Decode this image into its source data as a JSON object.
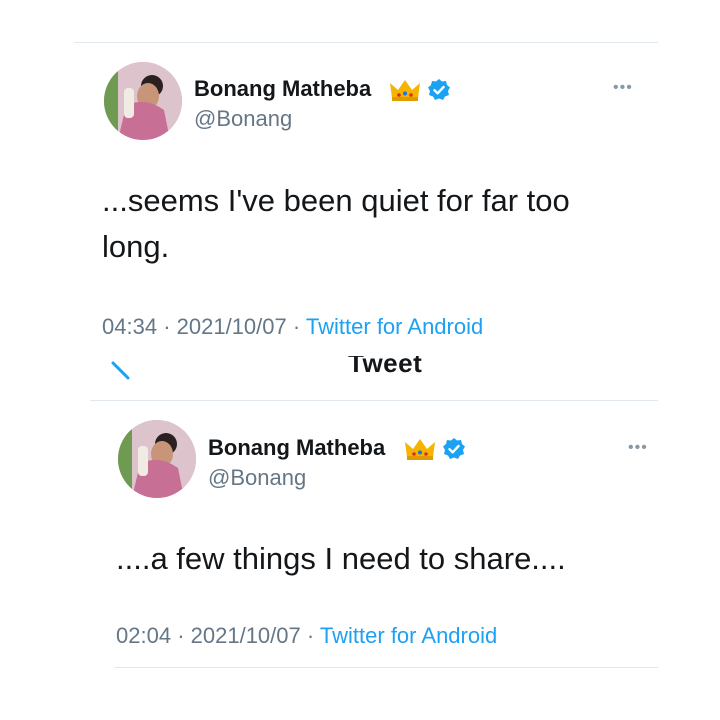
{
  "tweet1": {
    "name": "Bonang Matheba",
    "handle": "@Bonang",
    "text": "...seems I've been quiet for far too long.",
    "time": "04:34",
    "date": "2021/10/07",
    "separator": "·",
    "source": "Twitter for Android",
    "more": "•••"
  },
  "header": {
    "title": "Tweet"
  },
  "tweet2": {
    "name": "Bonang Matheba",
    "handle": "@Bonang",
    "text": "....a few things I need to share....",
    "time": "02:04",
    "date": "2021/10/07",
    "separator": "·",
    "source": "Twitter for Android",
    "more": "•••"
  },
  "icons": {
    "crown": "crown-emoji-icon",
    "verified": "verified-badge-icon",
    "more": "more-options-icon",
    "back": "back-arrow-icon"
  },
  "colors": {
    "accent": "#1da1f2",
    "muted": "#657786",
    "text": "#14171a",
    "divider": "#e1e8ed"
  }
}
